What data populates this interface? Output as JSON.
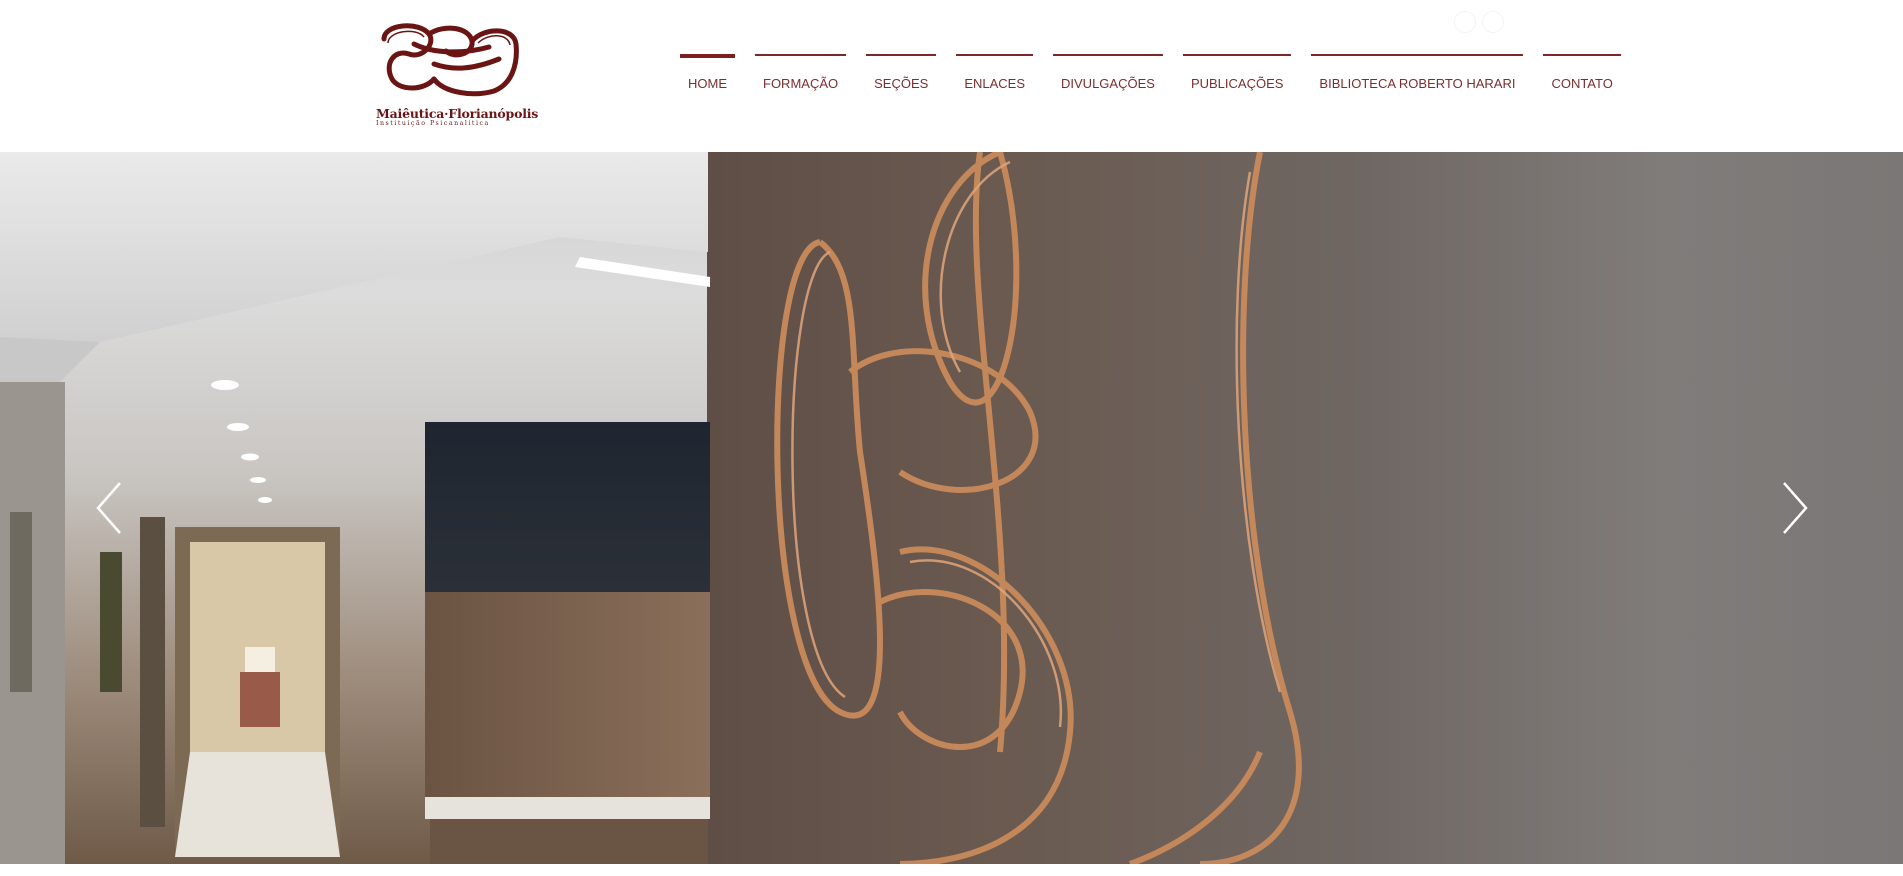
{
  "logo": {
    "title": "Maiêutica·Florianópolis",
    "subtitle": "Instituição Psicanalítica",
    "color": "#6b1414"
  },
  "nav": {
    "items": [
      {
        "label": "HOME",
        "active": true
      },
      {
        "label": "FORMAÇÃO",
        "active": false
      },
      {
        "label": "SEÇÕES",
        "active": false
      },
      {
        "label": "ENLACES",
        "active": false
      },
      {
        "label": "DIVULGAÇÕES",
        "active": false
      },
      {
        "label": "PUBLICAÇÕES",
        "active": false
      },
      {
        "label": "BIBLIOTECA ROBERTO HARARI",
        "active": false
      },
      {
        "label": "CONTATO",
        "active": false
      }
    ],
    "text_color": "#7a2e2e",
    "line_color": "#7d2828"
  },
  "social": {
    "icons": [
      "facebook-icon",
      "instagram-icon"
    ]
  },
  "slideshow": {
    "prev_icon": "chevron-left-icon",
    "next_icon": "chevron-right-icon"
  }
}
